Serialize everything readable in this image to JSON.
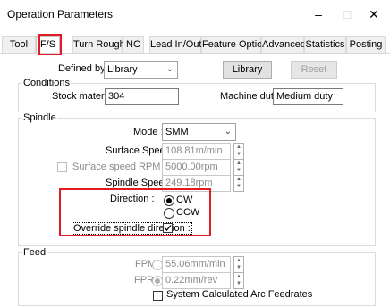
{
  "window": {
    "title": "Operation Parameters",
    "minimize_glyph": "–",
    "maximize_glyph": "□",
    "close_glyph": "✕"
  },
  "tabs": [
    {
      "label": "Tool"
    },
    {
      "label": "F/S"
    },
    {
      "label": "Turn Rough"
    },
    {
      "label": "NC"
    },
    {
      "label": "Lead In/Out"
    },
    {
      "label": "Feature Options"
    },
    {
      "label": "Advanced"
    },
    {
      "label": "Statistics"
    },
    {
      "label": "Posting"
    }
  ],
  "top": {
    "defined_by_label": "Defined by :",
    "defined_by_value": "Library",
    "library_button": "Library",
    "reset_button": "Reset"
  },
  "conditions": {
    "group_label": "Conditions",
    "stock_label": "Stock material :",
    "stock_value": "304",
    "duty_label": "Machine duty :",
    "duty_value": "Medium duty"
  },
  "spindle": {
    "group_label": "Spindle",
    "mode_label": "Mode :",
    "mode_value": "SMM",
    "surface_speed_label": "Surface Speed :",
    "surface_speed_value": "108.81m/min",
    "rpm_max_label": "Surface speed RPM max :",
    "rpm_max_value": "5000.00rpm",
    "spindle_speed_label": "Spindle Speed :",
    "spindle_speed_value": "249.18rpm",
    "direction_label": "Direction :",
    "cw_label": "CW",
    "ccw_label": "CCW",
    "override_label": "Override spindle direction :",
    "override_checked": true
  },
  "feed": {
    "group_label": "Feed",
    "fpm_label": "FPM",
    "fpm_value": "55.06mm/min",
    "fpr_label": "FPR",
    "fpr_value": "0.22mm/rev",
    "arc_label": "System Calculated Arc Feedrates"
  },
  "colors": {
    "highlight": "#e31b23"
  }
}
